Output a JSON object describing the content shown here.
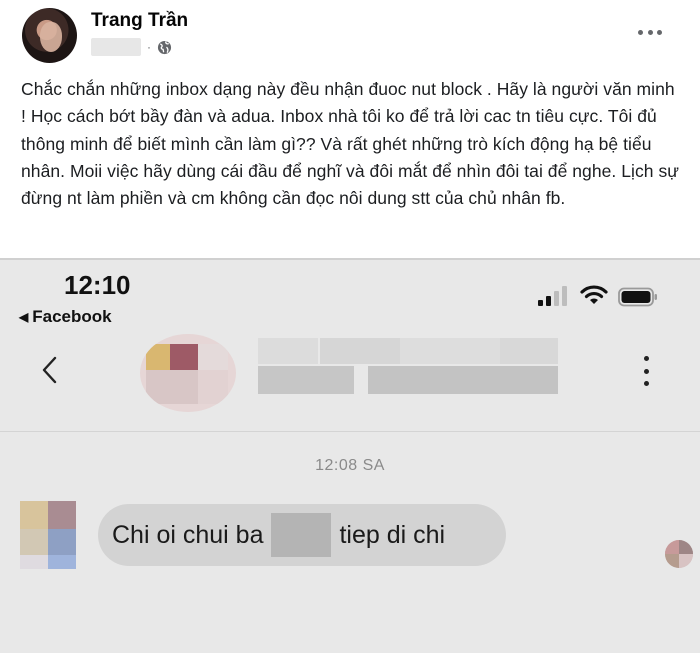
{
  "post": {
    "author": "Trang Trần",
    "separator": "·",
    "body": "Chắc chắn những inbox dạng này đều nhận đuoc nut block . Hãy là người văn minh ! Học cách bớt bầy đàn và adua. Inbox nhà tôi ko để trả lời cac tn tiêu cực. Tôi đủ thông minh để biết mình cần làm gì?? Và rất ghét những trò kích động hạ bệ tiểu nhân. Moii việc hãy dùng cái đầu để nghĩ và đôi mắt để nhìn đôi tai để nghe. Lịch sự đừng nt làm phiền và cm không cần đọc nôi dung stt của chủ nhân fb.",
    "icons": [
      "globe-icon",
      "more-horiz-icon"
    ]
  },
  "screenshot": {
    "status_time": "12:10",
    "back_arrow": "◀",
    "back_app": "Facebook",
    "icons": [
      "signal-icon",
      "wifi-icon",
      "battery-icon",
      "chevron-left-icon",
      "vertical-dots-icon"
    ],
    "timestamp": "12:08 SA",
    "message": {
      "before": "Chi oi chui ba",
      "after": "tiep di chi"
    }
  }
}
